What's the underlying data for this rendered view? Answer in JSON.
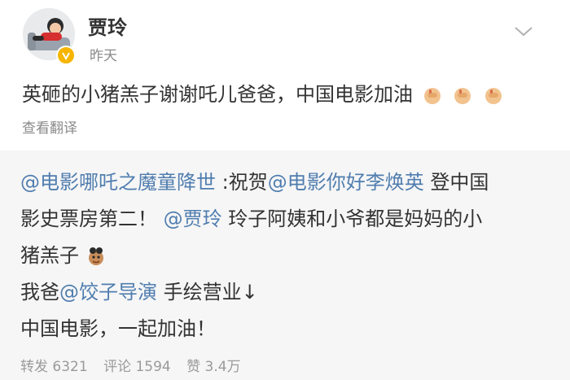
{
  "post": {
    "author": "贾玲",
    "time": "昨天",
    "text": "英砸的小猪羔子谢谢吒儿爸爸，中国电影加油",
    "emojis": [
      "fist-emoji",
      "fist-emoji",
      "fist-emoji"
    ],
    "translate_link": "查看翻译",
    "verified_badge": "V"
  },
  "repost": {
    "line1": {
      "mention1": "@电影哪吒之魔童降世",
      "text1": " :祝贺",
      "mention2": "@电影你好李焕英",
      "text2": " 登中国"
    },
    "line2": {
      "text1": "影史票房第二！",
      "mention1": "@贾玲",
      "text2": " 玲子阿姨和小爷都是妈妈的小"
    },
    "line3": {
      "text1": "猪羔子"
    },
    "line4": {
      "text1": "我爸",
      "mention1": "@饺子导演",
      "text2": " 手绘营业↓"
    },
    "line5": {
      "text1": "中国电影，一起加油！"
    },
    "stats": {
      "reposts": "转发 6321",
      "comments": "评论 1594",
      "likes": "赞 3.4万"
    }
  },
  "colors": {
    "mention": "#507daf",
    "repost_bg": "#f6f6f6",
    "badge": "#f7b500"
  }
}
